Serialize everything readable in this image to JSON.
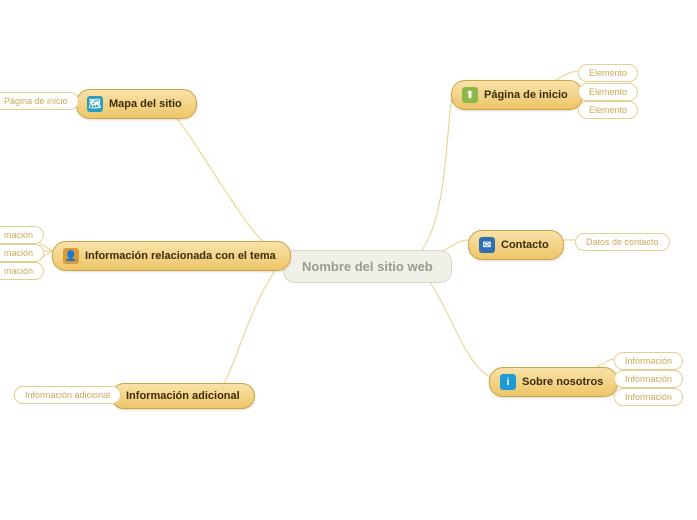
{
  "center": {
    "label": "Nombre del sitio web"
  },
  "right": {
    "pagina_inicio": {
      "label": "Página de inicio",
      "icon_bg": "#8cb84a",
      "icon_glyph": "⬆",
      "children": [
        "Elemento",
        "Elemento",
        "Elemento"
      ]
    },
    "contacto": {
      "label": "Contacto",
      "icon_bg": "#2f6fb0",
      "icon_glyph": "✉",
      "children": [
        "Datos de contacto"
      ]
    },
    "sobre_nosotros": {
      "label": "Sobre nosotros",
      "icon_bg": "#1e9ad6",
      "icon_glyph": "i",
      "children": [
        "Información",
        "Información",
        "Información"
      ]
    }
  },
  "left": {
    "mapa": {
      "label": "Mapa del sitio",
      "icon_bg": "#2a9cbf",
      "icon_glyph": "🗺",
      "children": [
        "Página de inicio"
      ]
    },
    "info_tema": {
      "label": "Información relacionada con el tema",
      "icon_bg": "#d99a3a",
      "icon_glyph": "👤",
      "children": [
        "mación",
        "mación",
        "mación"
      ]
    },
    "info_adicional": {
      "label": "Información adicional",
      "children": [
        "Información adicional"
      ]
    }
  }
}
